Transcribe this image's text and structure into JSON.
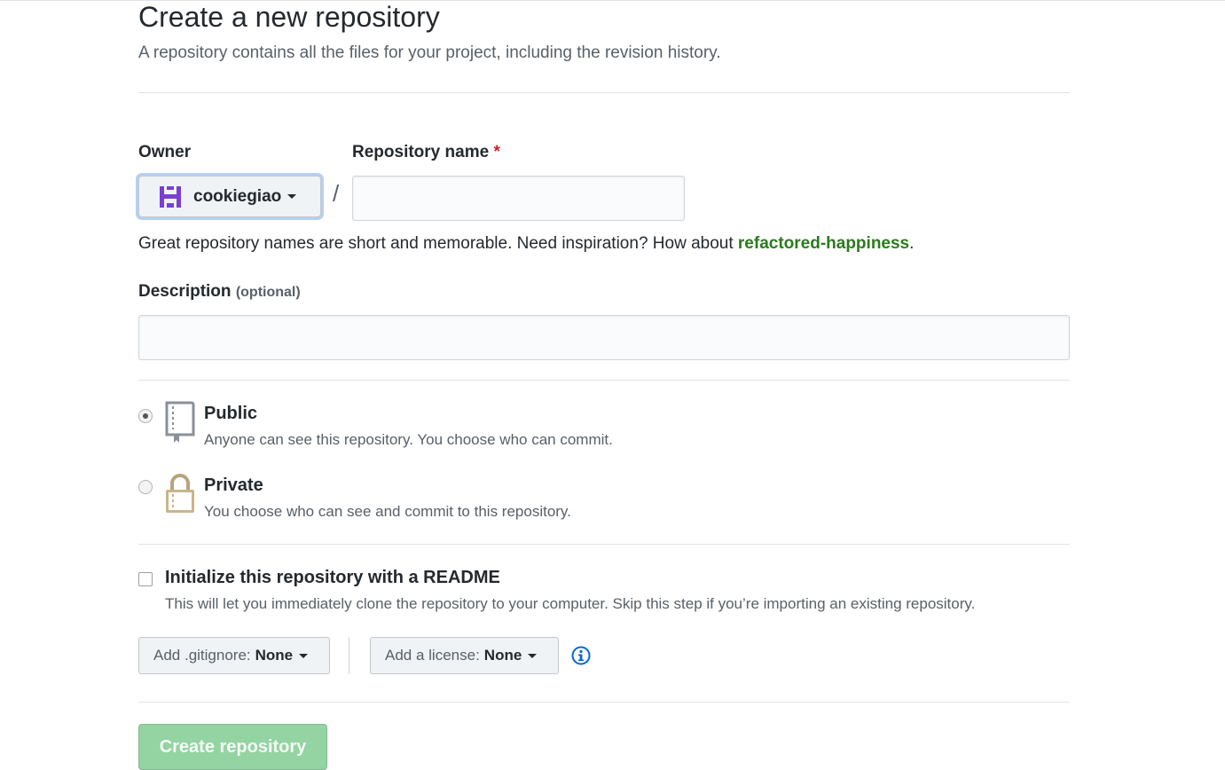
{
  "page": {
    "title": "Create a new repository",
    "subtitle": "A repository contains all the files for your project, including the revision history."
  },
  "owner": {
    "label": "Owner",
    "selected": "cookiegiao"
  },
  "repo_name": {
    "label": "Repository name",
    "required_mark": "*",
    "value": "",
    "separator": "/"
  },
  "hint": {
    "text": "Great repository names are short and memorable. Need inspiration? How about ",
    "suggestion": "refactored-happiness",
    "end": "."
  },
  "description": {
    "label": "Description",
    "optional": "(optional)",
    "value": ""
  },
  "visibility": {
    "public": {
      "title": "Public",
      "desc": "Anyone can see this repository. You choose who can commit.",
      "selected": true
    },
    "private": {
      "title": "Private",
      "desc": "You choose who can see and commit to this repository.",
      "selected": false
    }
  },
  "readme": {
    "title": "Initialize this repository with a README",
    "desc": "This will let you immediately clone the repository to your computer. Skip this step if you’re importing an existing repository.",
    "checked": false
  },
  "gitignore": {
    "label": "Add .gitignore:",
    "value": "None"
  },
  "license": {
    "label": "Add a license:",
    "value": "None"
  },
  "submit": {
    "label": "Create repository"
  },
  "colors": {
    "accent_green": "#2c7a1e",
    "button_green_disabled": "#94d3a2",
    "required_red": "#cb2431",
    "avatar_purple": "#7b3fd1",
    "info_blue": "#0366d6"
  }
}
